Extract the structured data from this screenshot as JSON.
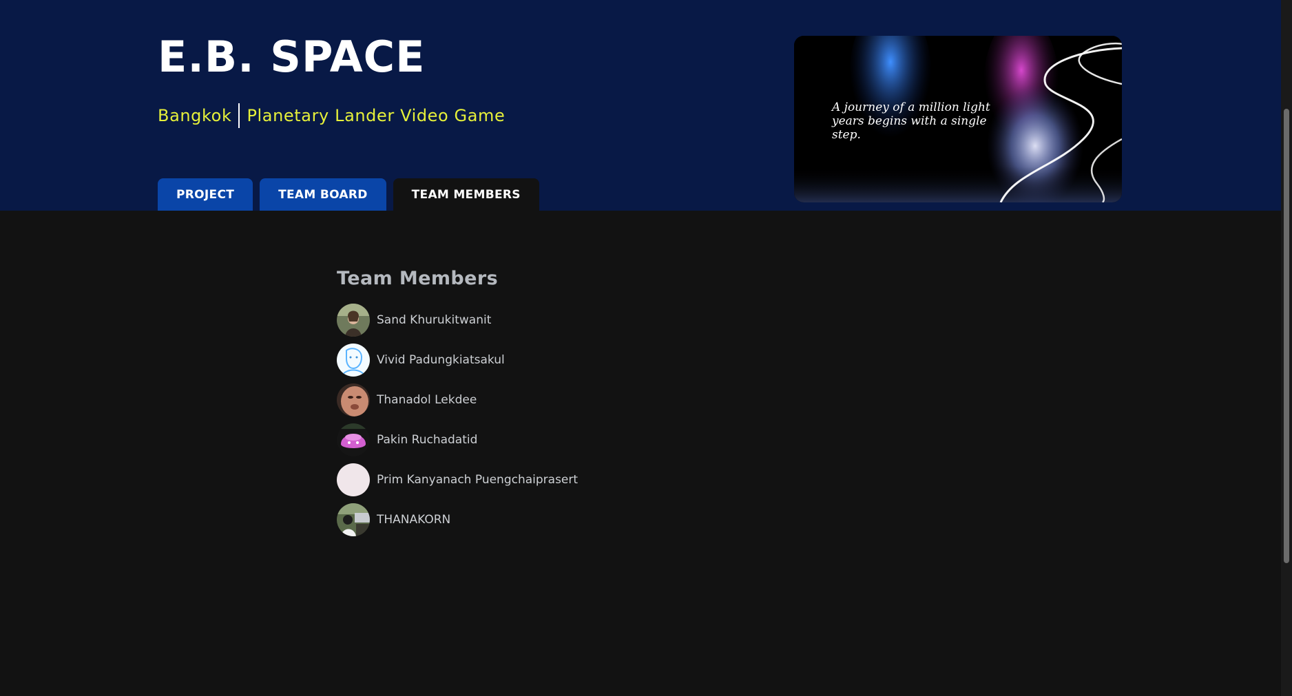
{
  "header": {
    "title": "E.B. SPACE",
    "location": "Bangkok",
    "project_type": "Planetary Lander Video Game",
    "background_color": "#081946",
    "subtitle_color": "#e6f03a"
  },
  "tabs": [
    {
      "label": "PROJECT",
      "active": false
    },
    {
      "label": "TEAM BOARD",
      "active": false
    },
    {
      "label": "TEAM MEMBERS",
      "active": true
    }
  ],
  "banner": {
    "quote": "A journey of a million light years begins with a single step."
  },
  "team": {
    "heading": "Team Members",
    "members": [
      {
        "name": "Sand Khurukitwanit",
        "avatar": "photo-avatar"
      },
      {
        "name": "Vivid Padungkiatsakul",
        "avatar": "sketch-avatar"
      },
      {
        "name": "Thanadol Lekdee",
        "avatar": "face-closeup-avatar"
      },
      {
        "name": "Pakin Ruchadatid",
        "avatar": "pink-creature-avatar"
      },
      {
        "name": "Prim Kanyanach Puengchaiprasert",
        "avatar": "blank-avatar"
      },
      {
        "name": "THANAKORN",
        "avatar": "outdoor-photo-avatar"
      }
    ]
  },
  "colors": {
    "page_background": "#121212",
    "tab_inactive": "#0a45a8",
    "member_text": "#cdd0d4"
  }
}
